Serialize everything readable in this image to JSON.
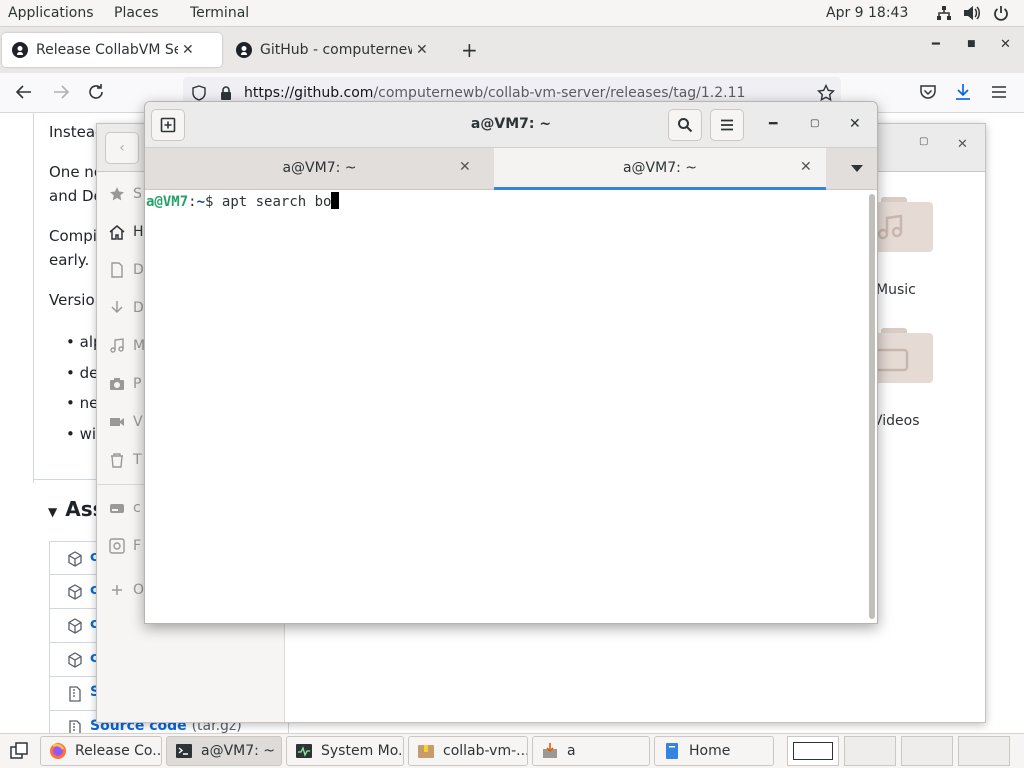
{
  "top_panel": {
    "menus": [
      "Applications",
      "Places",
      "Terminal"
    ],
    "clock": "Apr 9  18:43"
  },
  "browser": {
    "tabs": [
      {
        "title": "Release CollabVM Server",
        "active": true
      },
      {
        "title": "GitHub - computernewb/c",
        "active": false
      }
    ],
    "url_host": "https://github.com",
    "url_path": "/computernewb/collab-vm-server/releases/tag/1.2.11",
    "page": {
      "lines": [
        "Instead",
        "One no",
        "and De",
        "Compi",
        "early.",
        "Version"
      ],
      "bullets": [
        "alp",
        "de",
        "ne",
        "wi"
      ],
      "assets_heading": "Ass",
      "asset_rows": [
        "c",
        "c",
        "c",
        "c",
        "S"
      ],
      "source_code": {
        "label": "Source code",
        "suffix": "(tar.gz)"
      }
    }
  },
  "files_window": {
    "sidebar_items": [
      {
        "label": "S",
        "icon": "star-icon"
      },
      {
        "label": "H",
        "icon": "home-icon"
      },
      {
        "label": "D",
        "icon": "document-icon"
      },
      {
        "label": "D",
        "icon": "download-icon"
      },
      {
        "label": "M",
        "icon": "music-icon"
      },
      {
        "label": "P",
        "icon": "camera-icon"
      },
      {
        "label": "V",
        "icon": "video-icon"
      },
      {
        "label": "T",
        "icon": "trash-icon"
      },
      {
        "label": "c",
        "icon": "drive-icon"
      },
      {
        "label": "F",
        "icon": "disk-icon"
      },
      {
        "label": "O",
        "icon": "plus-icon"
      }
    ],
    "folders": [
      {
        "label": "Music"
      },
      {
        "label": "Videos"
      }
    ]
  },
  "terminal": {
    "title": "a@VM7: ~",
    "tabs": [
      {
        "label": "a@VM7: ~",
        "active": false
      },
      {
        "label": "a@VM7: ~",
        "active": true
      }
    ],
    "prompt_user": "a@VM7",
    "prompt_sep": ":",
    "prompt_path": "~",
    "prompt_suffix": "$ ",
    "command": "apt search bo"
  },
  "taskbar": {
    "items": [
      {
        "label": "Release Co...",
        "icon": "firefox-icon",
        "active": false
      },
      {
        "label": "a@VM7: ~",
        "icon": "terminal-icon",
        "active": true
      },
      {
        "label": "System Mo...",
        "icon": "system-monitor-icon",
        "active": false
      },
      {
        "label": "collab-vm-...",
        "icon": "archive-icon",
        "active": false
      },
      {
        "label": "a",
        "icon": "installer-icon",
        "active": false
      },
      {
        "label": "Home",
        "icon": "files-icon",
        "active": false
      }
    ],
    "workspaces": 4,
    "active_workspace": 1
  },
  "colors": {
    "prompt_user": "#26a269",
    "prompt_path": "#12488b",
    "tab_accent": "#3584e4",
    "link": "#0969da"
  }
}
